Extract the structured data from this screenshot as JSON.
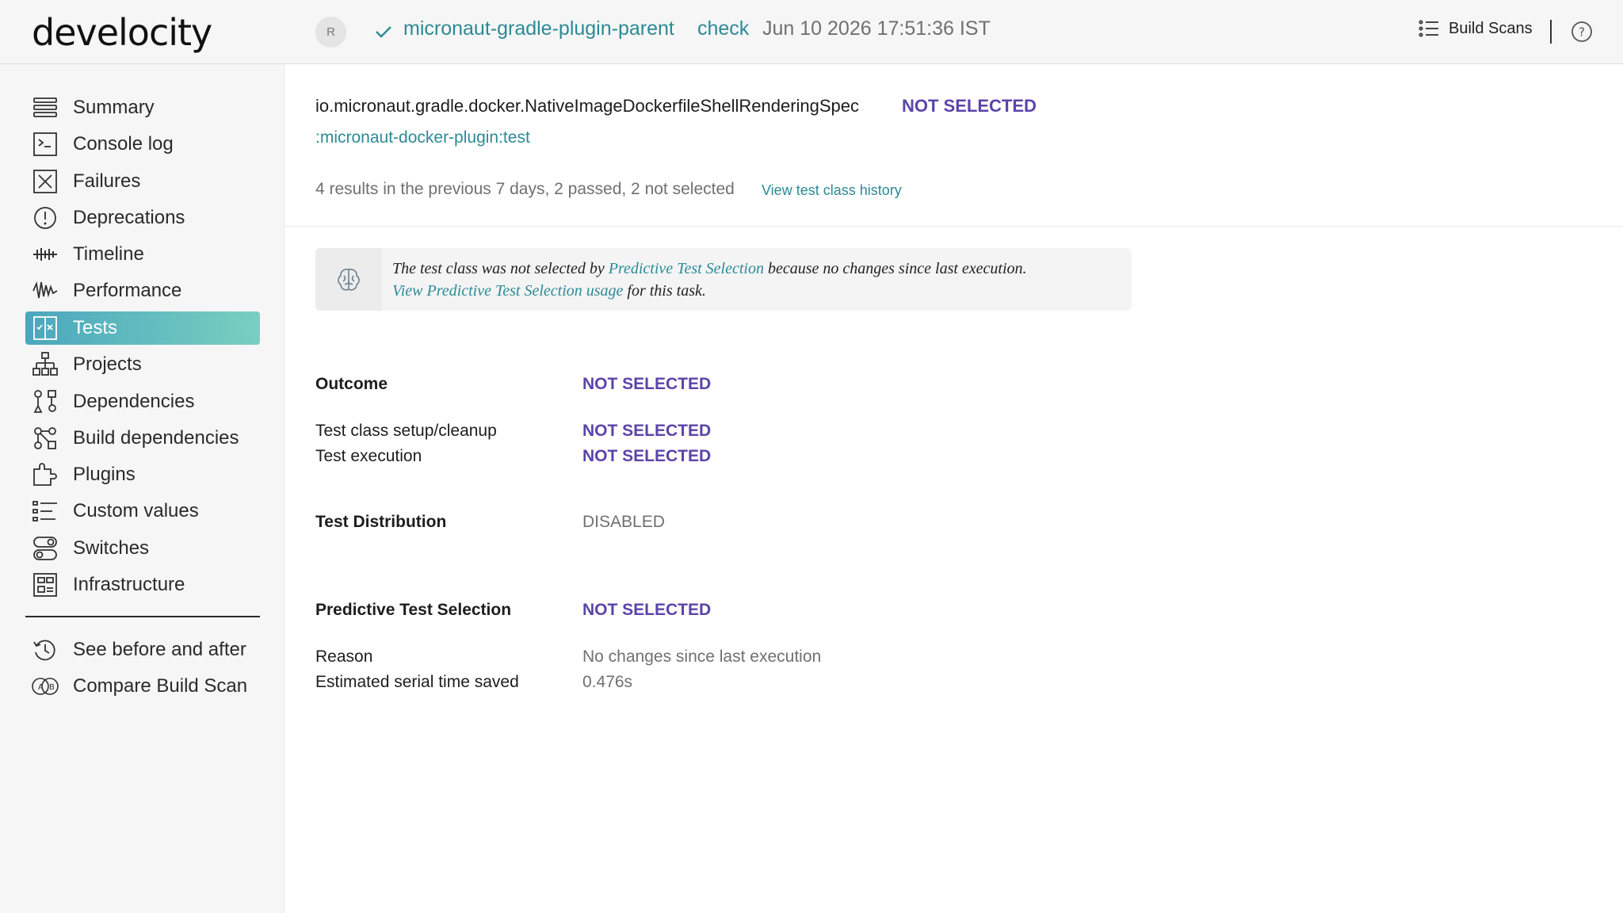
{
  "header": {
    "logo": "develocity",
    "avatar_initial": "R",
    "project": "micronaut-gradle-plugin-parent",
    "task": "check",
    "date": "Jun 10 2026 17:51:36 IST",
    "build_scans_label": "Build Scans"
  },
  "sidebar": {
    "items": [
      {
        "label": "Summary",
        "icon": "summary-icon"
      },
      {
        "label": "Console log",
        "icon": "console-icon"
      },
      {
        "label": "Failures",
        "icon": "failures-icon"
      },
      {
        "label": "Deprecations",
        "icon": "deprecations-icon"
      },
      {
        "label": "Timeline",
        "icon": "timeline-icon"
      },
      {
        "label": "Performance",
        "icon": "performance-icon"
      },
      {
        "label": "Tests",
        "icon": "tests-icon",
        "active": true
      },
      {
        "label": "Projects",
        "icon": "projects-icon"
      },
      {
        "label": "Dependencies",
        "icon": "dependencies-icon"
      },
      {
        "label": "Build dependencies",
        "icon": "build-dependencies-icon"
      },
      {
        "label": "Plugins",
        "icon": "plugins-icon"
      },
      {
        "label": "Custom values",
        "icon": "custom-values-icon"
      },
      {
        "label": "Switches",
        "icon": "switches-icon"
      },
      {
        "label": "Infrastructure",
        "icon": "infrastructure-icon"
      }
    ],
    "secondary": [
      {
        "label": "See before and after",
        "icon": "history-icon"
      },
      {
        "label": "Compare Build Scan",
        "icon": "compare-icon"
      }
    ]
  },
  "main": {
    "test_class": "io.micronaut.gradle.docker.NativeImageDockerfileShellRenderingSpec",
    "class_outcome": "NOT SELECTED",
    "task_path": ":micronaut-docker-plugin:test",
    "results_summary": "4 results in the previous 7 days, 2 passed, 2 not selected",
    "history_link": "View test class history",
    "banner": {
      "pre": "The test class was not selected by ",
      "link1": "Predictive Test Selection",
      "post": " because no changes since last execution.",
      "link2": "View Predictive Test Selection usage",
      "post2": " for this task."
    },
    "outcome": {
      "label": "Outcome",
      "value": "NOT SELECTED"
    },
    "setup": {
      "label": "Test class setup/cleanup",
      "value": "NOT SELECTED"
    },
    "execution": {
      "label": "Test execution",
      "value": "NOT SELECTED"
    },
    "distribution": {
      "label": "Test Distribution",
      "value": "DISABLED"
    },
    "pts": {
      "label": "Predictive Test Selection",
      "value": "NOT SELECTED"
    },
    "reason": {
      "label": "Reason",
      "value": "No changes since last execution"
    },
    "saved": {
      "label": "Estimated serial time saved",
      "value": "0.476s"
    }
  },
  "colors": {
    "accent_teal": "#2c8a95",
    "not_selected_purple": "#5a45a8",
    "muted_gray": "#707070"
  }
}
